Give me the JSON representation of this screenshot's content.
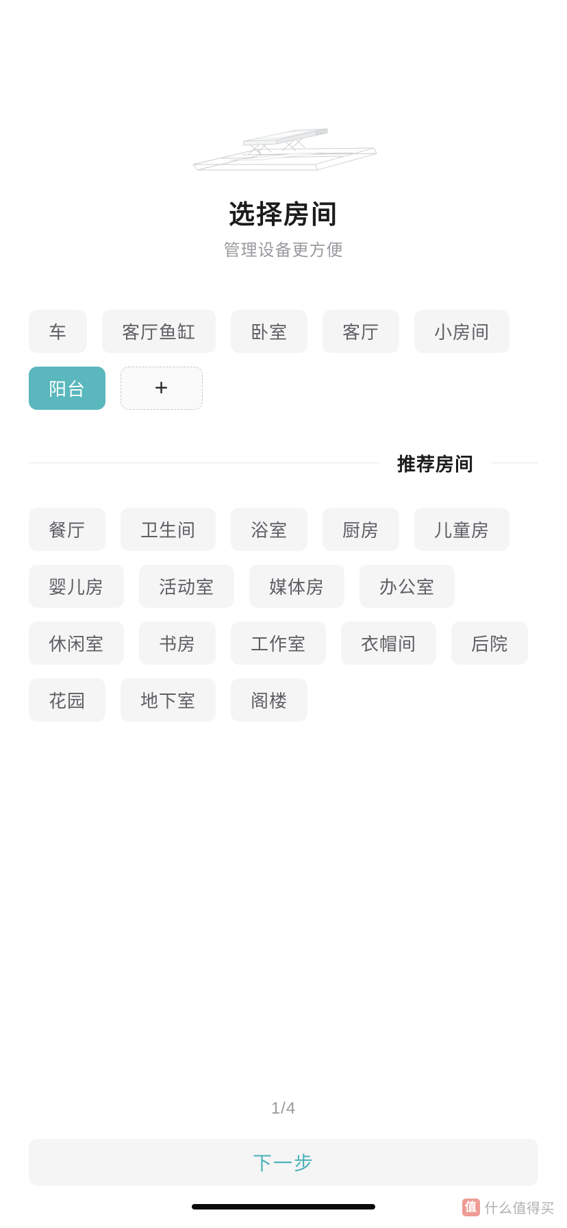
{
  "page": {
    "title": "选择房间",
    "subtitle": "管理设备更方便",
    "illustration_name": "clothes-drying-rack-device"
  },
  "my_rooms": {
    "chips": [
      {
        "label": "车",
        "selected": false
      },
      {
        "label": "客厅鱼缸",
        "selected": false
      },
      {
        "label": "卧室",
        "selected": false
      },
      {
        "label": "客厅",
        "selected": false
      },
      {
        "label": "小房间",
        "selected": false
      },
      {
        "label": "阳台",
        "selected": true
      }
    ],
    "add_label": "+"
  },
  "recommended": {
    "section_label": "推荐房间",
    "chips": [
      {
        "label": "餐厅"
      },
      {
        "label": "卫生间"
      },
      {
        "label": "浴室"
      },
      {
        "label": "厨房"
      },
      {
        "label": "儿童房"
      },
      {
        "label": "婴儿房"
      },
      {
        "label": "活动室"
      },
      {
        "label": "媒体房"
      },
      {
        "label": "办公室"
      },
      {
        "label": "休闲室"
      },
      {
        "label": "书房"
      },
      {
        "label": "工作室"
      },
      {
        "label": "衣帽间"
      },
      {
        "label": "后院"
      },
      {
        "label": "花园"
      },
      {
        "label": "地下室"
      },
      {
        "label": "阁楼"
      }
    ]
  },
  "footer": {
    "pager": "1/4",
    "next_label": "下一步"
  },
  "watermark": {
    "badge": "值",
    "text": "什么值得买"
  },
  "colors": {
    "accent_teal": "#59b7bd",
    "next_text": "#4eb3ba",
    "chip_bg": "#f5f5f6",
    "chip_text": "#5e5e63",
    "title": "#1c1c1e",
    "subtitle": "#9a9a9f"
  }
}
